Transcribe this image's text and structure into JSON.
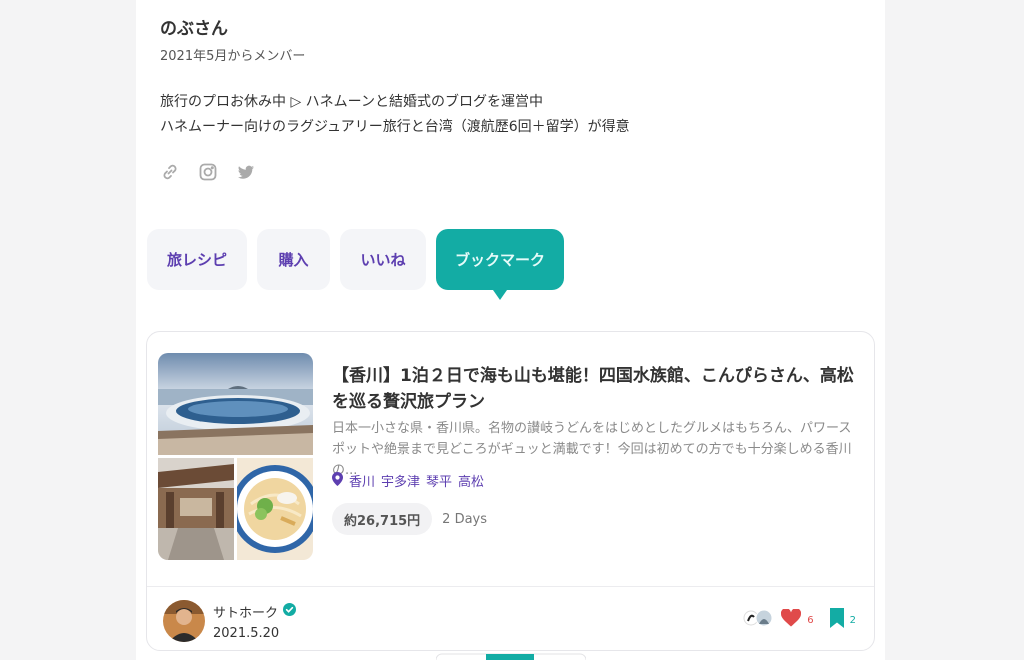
{
  "profile": {
    "name": "のぶさん",
    "member_since": "2021年5月からメンバー",
    "bio_line1": "旅行のプロお休み中 ▷ ハネムーンと結婚式のブログを運営中",
    "bio_line2": "ハネムーナー向けのラグジュアリー旅行と台湾（渡航歴6回＋留学）が得意"
  },
  "tabs": [
    {
      "label": "旅レシピ"
    },
    {
      "label": "購入"
    },
    {
      "label": "いいね"
    },
    {
      "label": "ブックマーク"
    }
  ],
  "card": {
    "title": "【香川】1泊２日で海も山も堪能！四国水族館、こんぴらさん、高松を巡る贅沢旅プラン",
    "description": "日本一小さな県・香川県。名物の讃岐うどんをはじめとしたグルメはもちろん、パワースポットや絶景まで見どころがギュッと満載です！今回は初めての方でも十分楽しめる香川の...",
    "tags": [
      "香川",
      "宇多津",
      "琴平",
      "高松"
    ],
    "price": "約26,715円",
    "duration": "2 Days",
    "author": {
      "name": "サトホーク",
      "date": "2021.5.20"
    },
    "likes": "6",
    "bookmarks": "2"
  },
  "colors": {
    "accent": "#13aca4",
    "purple": "#5d3fb0",
    "heart": "#e04a4a"
  }
}
